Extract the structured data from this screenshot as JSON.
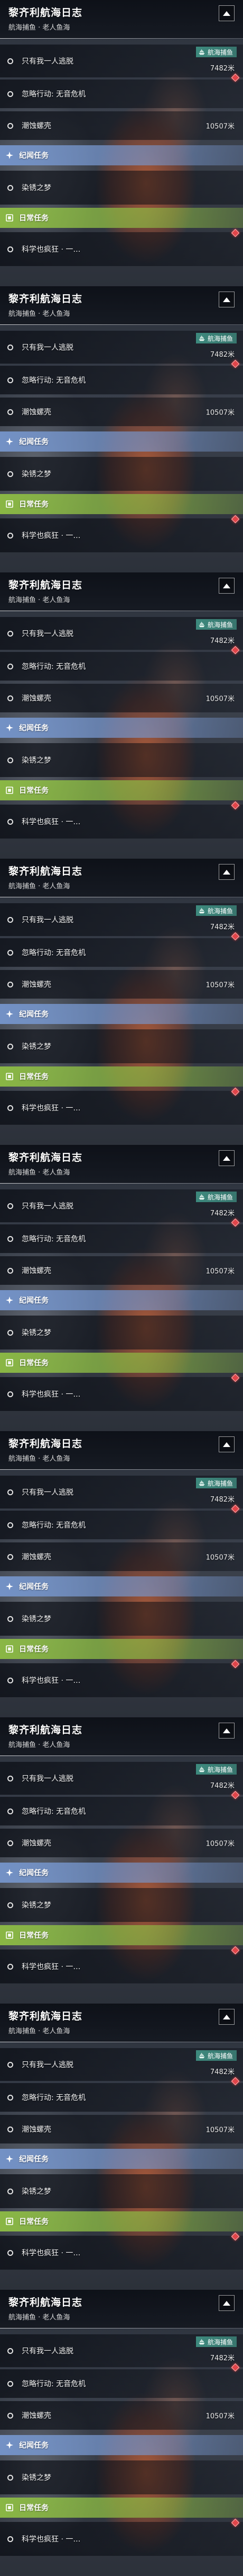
{
  "bullet_icon": "circle-bullet-icon",
  "collapse_icon": "collapse-icon",
  "colors": {
    "badge": "#3f8f82",
    "marker": "#e0454a"
  },
  "panels": [
    {
      "title": "黎齐利航海日志",
      "subtitle": "航海捕鱼 · 老人鱼海",
      "main_quests": [
        {
          "label": "只有我一人逃脱",
          "badge": {
            "label": "航海捕鱼",
            "icon": "ship-icon"
          },
          "distance": "7482米"
        },
        {
          "label": "忽略行动: 无音危机"
        },
        {
          "label": "潮蚀螺壳",
          "distance": "10507米"
        }
      ],
      "sections": [
        {
          "title": "纪闻任务",
          "icon": "lore-quest-icon",
          "accent": "#7696cd",
          "items": [
            {
              "label": "染锈之梦"
            }
          ]
        },
        {
          "title": "日常任务",
          "icon": "daily-quest-icon",
          "accent": "#8fbf44",
          "items": [
            {
              "label": "科学也疯狂 · 一…"
            }
          ]
        }
      ],
      "markers": [
        {
          "icon": "tracked-quest-marker-icon"
        },
        {
          "icon": "tracked-quest-marker-icon"
        }
      ]
    },
    {
      "title": "黎齐利航海日志",
      "subtitle": "航海捕鱼 · 老人鱼海",
      "main_quests": [
        {
          "label": "只有我一人逃脱",
          "badge": {
            "label": "航海捕鱼",
            "icon": "ship-icon"
          },
          "distance": "7482米"
        },
        {
          "label": "忽略行动: 无音危机"
        },
        {
          "label": "潮蚀螺壳",
          "distance": "10507米"
        }
      ],
      "sections": [
        {
          "title": "纪闻任务",
          "icon": "lore-quest-icon",
          "accent": "#7696cd",
          "items": [
            {
              "label": "染锈之梦"
            }
          ]
        },
        {
          "title": "日常任务",
          "icon": "daily-quest-icon",
          "accent": "#8fbf44",
          "items": [
            {
              "label": "科学也疯狂 · 一…"
            }
          ]
        }
      ],
      "markers": [
        {
          "icon": "tracked-quest-marker-icon"
        },
        {
          "icon": "tracked-quest-marker-icon"
        }
      ]
    },
    {
      "title": "黎齐利航海日志",
      "subtitle": "航海捕鱼 · 老人鱼海",
      "main_quests": [
        {
          "label": "只有我一人逃脱",
          "badge": {
            "label": "航海捕鱼",
            "icon": "ship-icon"
          },
          "distance": "7482米"
        },
        {
          "label": "忽略行动: 无音危机"
        },
        {
          "label": "潮蚀螺壳",
          "distance": "10507米"
        }
      ],
      "sections": [
        {
          "title": "纪闻任务",
          "icon": "lore-quest-icon",
          "accent": "#7696cd",
          "items": [
            {
              "label": "染锈之梦"
            }
          ]
        },
        {
          "title": "日常任务",
          "icon": "daily-quest-icon",
          "accent": "#8fbf44",
          "items": [
            {
              "label": "科学也疯狂 · 一…"
            }
          ]
        }
      ],
      "markers": [
        {
          "icon": "tracked-quest-marker-icon"
        },
        {
          "icon": "tracked-quest-marker-icon"
        }
      ]
    },
    {
      "title": "黎齐利航海日志",
      "subtitle": "航海捕鱼 · 老人鱼海",
      "main_quests": [
        {
          "label": "只有我一人逃脱",
          "badge": {
            "label": "航海捕鱼",
            "icon": "ship-icon"
          },
          "distance": "7482米"
        },
        {
          "label": "忽略行动: 无音危机"
        },
        {
          "label": "潮蚀螺壳",
          "distance": "10507米"
        }
      ],
      "sections": [
        {
          "title": "纪闻任务",
          "icon": "lore-quest-icon",
          "accent": "#7696cd",
          "items": [
            {
              "label": "染锈之梦"
            }
          ]
        },
        {
          "title": "日常任务",
          "icon": "daily-quest-icon",
          "accent": "#8fbf44",
          "items": [
            {
              "label": "科学也疯狂 · 一…"
            }
          ]
        }
      ],
      "markers": [
        {
          "icon": "tracked-quest-marker-icon"
        },
        {
          "icon": "tracked-quest-marker-icon"
        }
      ]
    },
    {
      "title": "黎齐利航海日志",
      "subtitle": "航海捕鱼 · 老人鱼海",
      "main_quests": [
        {
          "label": "只有我一人逃脱",
          "badge": {
            "label": "航海捕鱼",
            "icon": "ship-icon"
          },
          "distance": "7482米"
        },
        {
          "label": "忽略行动: 无音危机"
        },
        {
          "label": "潮蚀螺壳",
          "distance": "10507米"
        }
      ],
      "sections": [
        {
          "title": "纪闻任务",
          "icon": "lore-quest-icon",
          "accent": "#7696cd",
          "items": [
            {
              "label": "染锈之梦"
            }
          ]
        },
        {
          "title": "日常任务",
          "icon": "daily-quest-icon",
          "accent": "#8fbf44",
          "items": [
            {
              "label": "科学也疯狂 · 一…"
            }
          ]
        }
      ],
      "markers": [
        {
          "icon": "tracked-quest-marker-icon"
        },
        {
          "icon": "tracked-quest-marker-icon"
        }
      ]
    },
    {
      "title": "黎齐利航海日志",
      "subtitle": "航海捕鱼 · 老人鱼海",
      "main_quests": [
        {
          "label": "只有我一人逃脱",
          "badge": {
            "label": "航海捕鱼",
            "icon": "ship-icon"
          },
          "distance": "7482米"
        },
        {
          "label": "忽略行动: 无音危机"
        },
        {
          "label": "潮蚀螺壳",
          "distance": "10507米"
        }
      ],
      "sections": [
        {
          "title": "纪闻任务",
          "icon": "lore-quest-icon",
          "accent": "#7696cd",
          "items": [
            {
              "label": "染锈之梦"
            }
          ]
        },
        {
          "title": "日常任务",
          "icon": "daily-quest-icon",
          "accent": "#8fbf44",
          "items": [
            {
              "label": "科学也疯狂 · 一…"
            }
          ]
        }
      ],
      "markers": [
        {
          "icon": "tracked-quest-marker-icon"
        },
        {
          "icon": "tracked-quest-marker-icon"
        }
      ]
    },
    {
      "title": "黎齐利航海日志",
      "subtitle": "航海捕鱼 · 老人鱼海",
      "main_quests": [
        {
          "label": "只有我一人逃脱",
          "badge": {
            "label": "航海捕鱼",
            "icon": "ship-icon"
          },
          "distance": "7482米"
        },
        {
          "label": "忽略行动: 无音危机"
        },
        {
          "label": "潮蚀螺壳",
          "distance": "10507米"
        }
      ],
      "sections": [
        {
          "title": "纪闻任务",
          "icon": "lore-quest-icon",
          "accent": "#7696cd",
          "items": [
            {
              "label": "染锈之梦"
            }
          ]
        },
        {
          "title": "日常任务",
          "icon": "daily-quest-icon",
          "accent": "#8fbf44",
          "items": [
            {
              "label": "科学也疯狂 · 一…"
            }
          ]
        }
      ],
      "markers": [
        {
          "icon": "tracked-quest-marker-icon"
        },
        {
          "icon": "tracked-quest-marker-icon"
        }
      ]
    },
    {
      "title": "黎齐利航海日志",
      "subtitle": "航海捕鱼 · 老人鱼海",
      "main_quests": [
        {
          "label": "只有我一人逃脱",
          "badge": {
            "label": "航海捕鱼",
            "icon": "ship-icon"
          },
          "distance": "7482米"
        },
        {
          "label": "忽略行动: 无音危机"
        },
        {
          "label": "潮蚀螺壳",
          "distance": "10507米"
        }
      ],
      "sections": [
        {
          "title": "纪闻任务",
          "icon": "lore-quest-icon",
          "accent": "#7696cd",
          "items": [
            {
              "label": "染锈之梦"
            }
          ]
        },
        {
          "title": "日常任务",
          "icon": "daily-quest-icon",
          "accent": "#8fbf44",
          "items": [
            {
              "label": "科学也疯狂 · 一…"
            }
          ]
        }
      ],
      "markers": [
        {
          "icon": "tracked-quest-marker-icon"
        },
        {
          "icon": "tracked-quest-marker-icon"
        }
      ]
    },
    {
      "title": "黎齐利航海日志",
      "subtitle": "航海捕鱼 · 老人鱼海",
      "main_quests": [
        {
          "label": "只有我一人逃脱",
          "badge": {
            "label": "航海捕鱼",
            "icon": "ship-icon"
          },
          "distance": "7482米"
        },
        {
          "label": "忽略行动: 无音危机"
        },
        {
          "label": "潮蚀螺壳",
          "distance": "10507米"
        }
      ],
      "sections": [
        {
          "title": "纪闻任务",
          "icon": "lore-quest-icon",
          "accent": "#7696cd",
          "items": [
            {
              "label": "染锈之梦"
            }
          ]
        },
        {
          "title": "日常任务",
          "icon": "daily-quest-icon",
          "accent": "#8fbf44",
          "items": [
            {
              "label": "科学也疯狂 · 一…"
            }
          ]
        }
      ],
      "markers": [
        {
          "icon": "tracked-quest-marker-icon"
        },
        {
          "icon": "tracked-quest-marker-icon"
        }
      ]
    }
  ]
}
